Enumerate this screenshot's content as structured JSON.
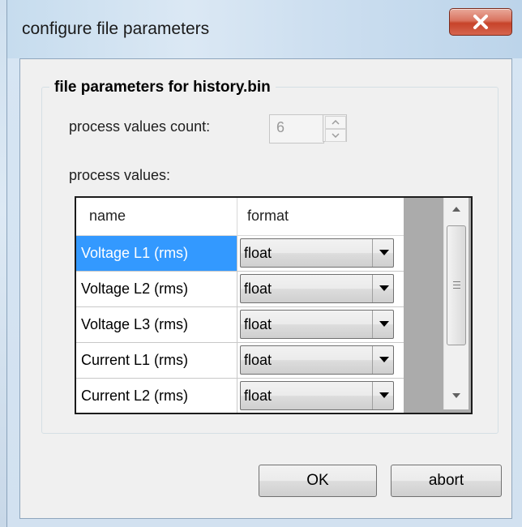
{
  "window": {
    "title": "configure file parameters"
  },
  "group": {
    "title": "file parameters for history.bin"
  },
  "count": {
    "label": "process values count:",
    "value": "6"
  },
  "values_label": "process values:",
  "grid": {
    "columns": [
      "name",
      "format"
    ],
    "rows": [
      {
        "name": "Voltage L1 (rms)",
        "format": "float"
      },
      {
        "name": "Voltage L2 (rms)",
        "format": "float"
      },
      {
        "name": "Voltage L3 (rms)",
        "format": "float"
      },
      {
        "name": "Current L1 (rms)",
        "format": "float"
      },
      {
        "name": "Current L2 (rms)",
        "format": "float"
      }
    ],
    "selected_row": 0
  },
  "buttons": {
    "ok": "OK",
    "abort": "abort"
  },
  "icons": {
    "close": "close-icon",
    "spin_up": "chevron-up-icon",
    "spin_down": "chevron-down-icon",
    "dropdown": "dropdown-arrow-icon",
    "scroll_up": "scroll-up-icon",
    "scroll_down": "scroll-down-icon"
  },
  "colors": {
    "selection": "#3399ff",
    "close_button": "#c7432a"
  }
}
